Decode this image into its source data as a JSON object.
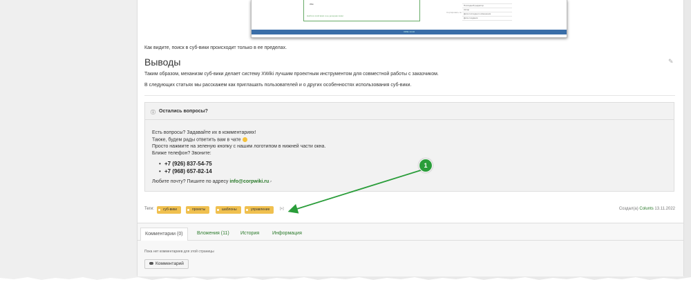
{
  "embedded_screenshot": {
    "wiki_label": "Wiki",
    "check_label": "Найти в этой вики и ее дочерних вики",
    "right_label": "Сортировать по",
    "right_items": [
      "",
      "Последний редактор",
      "Автор",
      "Дата последнего изменения",
      "Дата создания"
    ],
    "footer_text": "XWiki 14.10"
  },
  "article": {
    "intro_line": "Как видите, поиск в суб-вики происходит только в ее пределах.",
    "heading": "Выводы",
    "para1": "Таким образом, механизм суб-вики делает систему XWiki лучшим проектным инструментом для совместной работы с заказчиком.",
    "para2": "В следующих статьях мы расскажем как приглашать пользователей и о других особенностях использования суб-вики."
  },
  "questions_box": {
    "title": "Остались вопросы?",
    "line1": "Есть вопросы? Задавайте их в комментариях!",
    "line2": "Также, будем рады ответить вам в чате",
    "line3": "Просто нажмите на зеленую кнопку с нашим логотипом в нижней части окна.",
    "line4": "Ближе телефон? Звоните:",
    "phones": [
      "+7 (926) 837-54-75",
      "+7 (968) 657-82-14"
    ],
    "email_prefix": "Любите почту? Пишите по адресу",
    "email": "info@corpwiki.ru",
    "external_mark": "↗"
  },
  "tags": {
    "label": "Теги:",
    "items": [
      "суб-вики",
      "проекты",
      "шаблоны",
      "управление"
    ],
    "add": "[+]"
  },
  "created": {
    "prefix": "Создал(а)",
    "author": "Colunts",
    "date": "13.11.2022"
  },
  "tabs": [
    {
      "label": "Комментарии (0)"
    },
    {
      "label": "Вложения (11)"
    },
    {
      "label": "История"
    },
    {
      "label": "Информация"
    }
  ],
  "comments": {
    "empty_text": "Пока нет комментариев для этой страницы",
    "button_label": "Комментарий"
  },
  "annotation": {
    "badge_number": "1",
    "color": "#2a9d3a"
  }
}
